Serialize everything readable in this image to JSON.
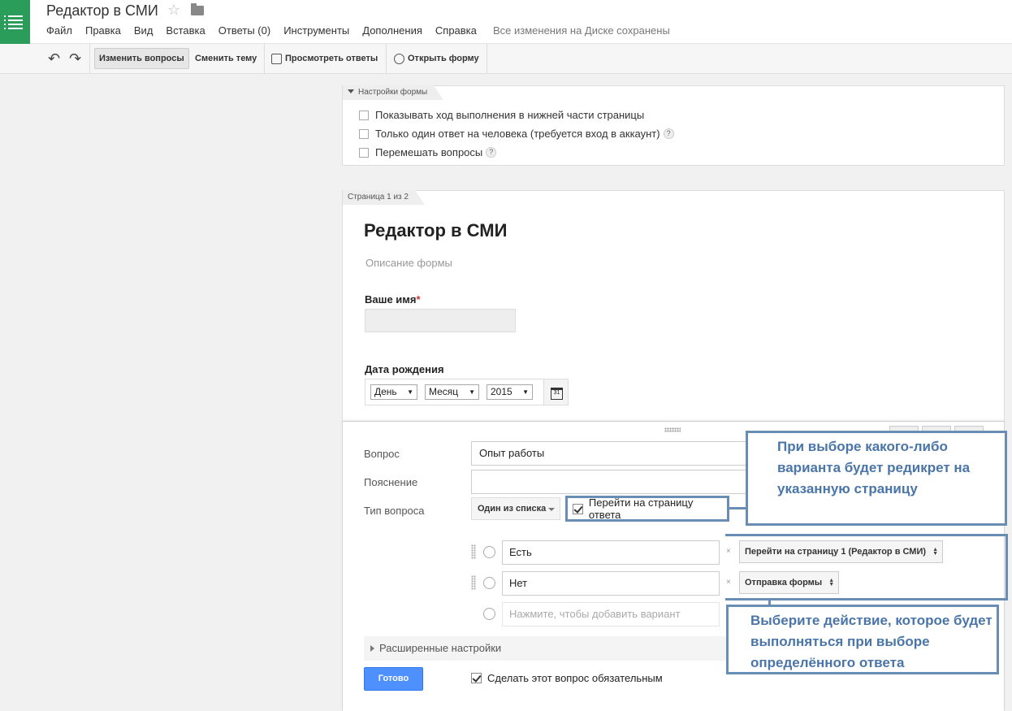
{
  "header": {
    "title": "Редактор в СМИ",
    "menu": [
      "Файл",
      "Правка",
      "Вид",
      "Вставка",
      "Ответы (0)",
      "Инструменты",
      "Дополнения",
      "Справка"
    ],
    "save_status": "Все изменения на Диске сохранены"
  },
  "toolbar": {
    "edit_questions": "Изменить вопросы",
    "change_theme": "Сменить тему",
    "view_responses": "Просмотреть ответы",
    "open_form": "Открыть форму"
  },
  "settings": {
    "tab": "Настройки формы",
    "options": [
      "Показывать ход выполнения в нижней части страницы",
      "Только один ответ на человека (требуется вход в аккаунт)",
      "Перемешать вопросы"
    ],
    "help": "?"
  },
  "page": {
    "tab": "Страница 1 из 2",
    "form_title": "Редактор в СМИ",
    "form_description": "Описание формы",
    "name_label": "Ваше имя",
    "required_mark": "*",
    "dob_label": "Дата рождения",
    "day": "День",
    "month": "Месяц",
    "year": "2015"
  },
  "editor": {
    "question_label": "Вопрос",
    "question_value": "Опыт работы",
    "hint_label": "Пояснение",
    "hint_value": "",
    "type_label": "Тип вопроса",
    "type_value": "Один из списка",
    "goto_page_label": "Перейти на страницу ответа",
    "options": [
      {
        "value": "Есть",
        "action": "Перейти на страницу 1 (Редактор в СМИ)"
      },
      {
        "value": "Нет",
        "action": "Отправка формы"
      }
    ],
    "add_option_placeholder": "Нажмите, чтобы добавить вариант",
    "advanced": "Расширенные настройки",
    "done": "Готово",
    "required": "Сделать этот вопрос обязательным"
  },
  "annotations": {
    "top": "При выборе какого-либо варианта будет редикрет на указанную страницу",
    "bottom": "Выберите действие, которое будет выполняться при выборе определённого ответа"
  },
  "colors": {
    "accent": "#4d90fe",
    "app_green": "#2a9d5b",
    "annotation": "#6a8db3"
  }
}
